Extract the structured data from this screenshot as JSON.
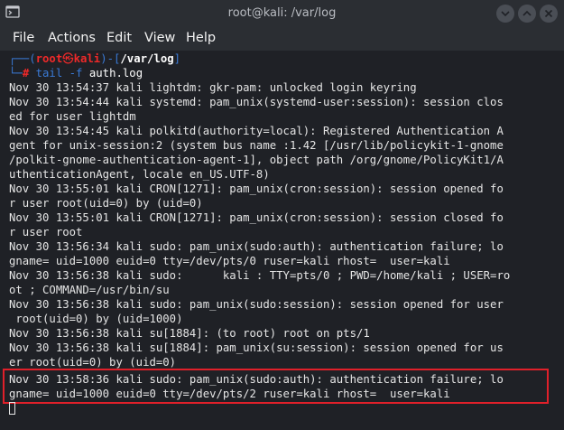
{
  "window": {
    "title": "root@kali: /var/log"
  },
  "menubar": {
    "items": [
      "File",
      "Actions",
      "Edit",
      "View",
      "Help"
    ]
  },
  "prompt": {
    "open_bracket": "┌──(",
    "user": "root",
    "skull": "㉿",
    "host": "kali",
    "mid": ")-[",
    "path": "/var/log",
    "close": "]",
    "corner": "└─",
    "hash": "#",
    "command": "tail",
    "flag": "-f",
    "arg": "auth.log"
  },
  "log_lines": [
    "Nov 30 13:54:37 kali lightdm: gkr-pam: unlocked login keyring",
    "Nov 30 13:54:44 kali systemd: pam_unix(systemd-user:session): session clos",
    "ed for user lightdm",
    "Nov 30 13:54:45 kali polkitd(authority=local): Registered Authentication A",
    "gent for unix-session:2 (system bus name :1.42 [/usr/lib/policykit-1-gnome",
    "/polkit-gnome-authentication-agent-1], object path /org/gnome/PolicyKit1/A",
    "uthenticationAgent, locale en_US.UTF-8)",
    "Nov 30 13:55:01 kali CRON[1271]: pam_unix(cron:session): session opened fo",
    "r user root(uid=0) by (uid=0)",
    "Nov 30 13:55:01 kali CRON[1271]: pam_unix(cron:session): session closed fo",
    "r user root",
    "Nov 30 13:56:34 kali sudo: pam_unix(sudo:auth): authentication failure; lo",
    "gname= uid=1000 euid=0 tty=/dev/pts/0 ruser=kali rhost=  user=kali",
    "Nov 30 13:56:38 kali sudo:      kali : TTY=pts/0 ; PWD=/home/kali ; USER=ro",
    "ot ; COMMAND=/usr/bin/su",
    "Nov 30 13:56:38 kali sudo: pam_unix(sudo:session): session opened for user",
    " root(uid=0) by (uid=1000)",
    "Nov 30 13:56:38 kali su[1884]: (to root) root on pts/1",
    "Nov 30 13:56:38 kali su[1884]: pam_unix(su:session): session opened for us",
    "er root(uid=0) by (uid=0)",
    "Nov 30 13:58:36 kali sudo: pam_unix(sudo:auth): authentication failure; lo",
    "gname= uid=1000 euid=0 tty=/dev/pts/2 ruser=kali rhost=  user=kali"
  ],
  "colors": {
    "background": "#1f2126",
    "prompt_blue": "#3a7ad6",
    "prompt_red": "#ef2929",
    "highlight_border": "#e0202a"
  }
}
